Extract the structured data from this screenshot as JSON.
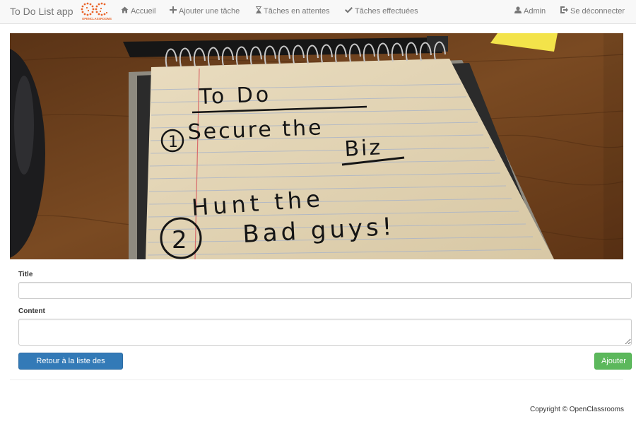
{
  "navbar": {
    "brand": "To Do List app",
    "logo_text": "OPENCLASSROOMS",
    "home_label": "Accueil",
    "add_label": "Ajouter une tâche",
    "pending_label": "Tâches en attentes",
    "done_label": "Tâches effectuées",
    "admin_label": "Admin",
    "logout_label": "Se déconnecter",
    "icons": {
      "home": "home-icon",
      "add": "plus-icon",
      "pending": "hourglass-icon",
      "done": "check-icon",
      "admin": "user-icon",
      "logout": "logout-icon"
    }
  },
  "hero": {
    "notepad_heading": "To Do",
    "notepad_item_1_number": "1",
    "notepad_item_1": "Secure the",
    "notepad_item_1_line2": "Biz",
    "notepad_item_2_line1": "Hunt the",
    "notepad_item_2_number": "2",
    "notepad_item_2": "Bad guys!"
  },
  "form": {
    "title_label": "Title",
    "title_value": "",
    "content_label": "Content",
    "content_value": "",
    "back_button": "Retour à la liste des tâches",
    "submit_button": "Ajouter"
  },
  "footer": {
    "copyright": "Copyright © OpenClassrooms"
  },
  "colors": {
    "primary": "#337ab7",
    "success": "#5cb85c",
    "navbar_bg": "#f8f8f8",
    "logo_orange": "#e9642a"
  }
}
